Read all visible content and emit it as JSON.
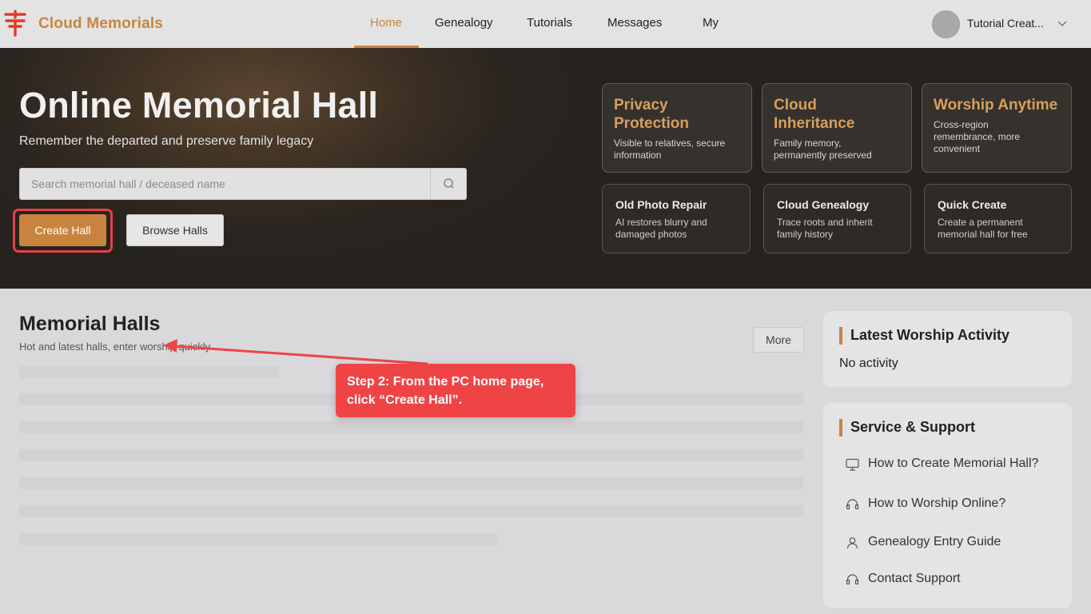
{
  "header": {
    "brand": "Cloud Memorials",
    "nav": [
      "Home",
      "Genealogy",
      "Tutorials",
      "Messages",
      "My"
    ],
    "active_nav": "Home",
    "user_name": "Tutorial Creat..."
  },
  "hero": {
    "title": "Online Memorial Hall",
    "subtitle": "Remember the departed and preserve family legacy",
    "search_placeholder": "Search memorial hall / deceased name",
    "create_label": "Create Hall",
    "browse_label": "Browse Halls",
    "features_top": [
      {
        "title": "Privacy Protection",
        "desc": "Visible to relatives, secure information"
      },
      {
        "title": "Cloud Inheritance",
        "desc": "Family memory, permanently preserved"
      },
      {
        "title": "Worship Anytime",
        "desc": "Cross-region remembrance, more convenient"
      }
    ],
    "features_bottom": [
      {
        "title": "Old Photo Repair",
        "desc": "AI restores blurry and damaged photos"
      },
      {
        "title": "Cloud Genealogy",
        "desc": "Trace roots and inherit family history"
      },
      {
        "title": "Quick Create",
        "desc": "Create a permanent memorial hall for free"
      }
    ]
  },
  "halls": {
    "title": "Memorial Halls",
    "subtitle": "Hot and latest halls, enter worship quickly",
    "more_label": "More"
  },
  "activity": {
    "title": "Latest Worship Activity",
    "empty": "No activity"
  },
  "support": {
    "title": "Service & Support",
    "items": [
      {
        "label": "How to Create Memorial Hall?",
        "icon": "monitor-icon"
      },
      {
        "label": "How to Worship Online?",
        "icon": "headset-icon"
      },
      {
        "label": "Genealogy Entry Guide",
        "icon": "user-icon"
      },
      {
        "label": "Contact Support",
        "icon": "headset-icon"
      }
    ]
  },
  "annotation": {
    "text": "Step 2: From the PC home page, click “Create Hall”."
  },
  "colors": {
    "accent": "#c8843f",
    "highlight": "#e5404a",
    "tooltip": "#ef4446"
  }
}
